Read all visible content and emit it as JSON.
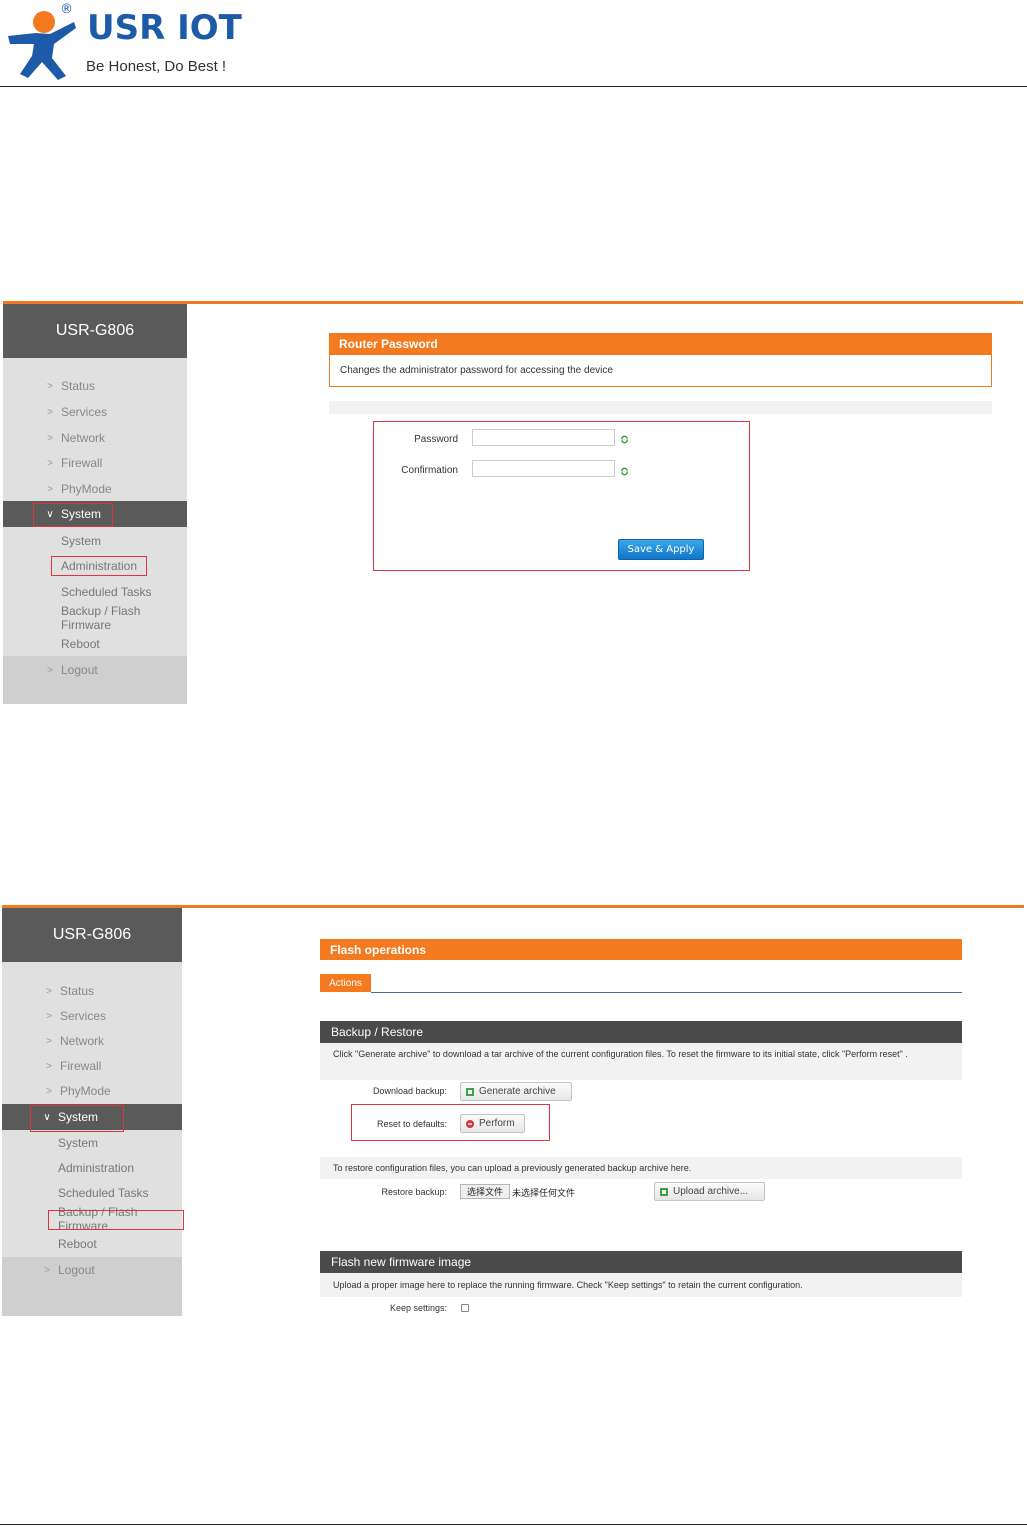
{
  "header": {
    "brand": "USR IOT",
    "registered": "®",
    "slogan": "Be Honest, Do Best !"
  },
  "colors": {
    "accent": "#f47a20",
    "brand": "#1d5aa8",
    "sidebar_bg": "#e0e0e0",
    "sidebar_dark": "#5a5a5a",
    "highlight_box": "#e0343b",
    "primary_button": "#1a86d6"
  },
  "screenshot1": {
    "device_title": "USR-G806",
    "menu": [
      {
        "label": "Status",
        "icon": "chevron-right-icon"
      },
      {
        "label": "Services",
        "icon": "chevron-right-icon"
      },
      {
        "label": "Network",
        "icon": "chevron-right-icon"
      },
      {
        "label": "Firewall",
        "icon": "chevron-right-icon"
      },
      {
        "label": "PhyMode",
        "icon": "chevron-right-icon"
      },
      {
        "label": "System",
        "icon": "chevron-down-icon",
        "active": true
      }
    ],
    "submenu": [
      "System",
      "Administration",
      "Scheduled Tasks",
      "Backup / Flash Firmware",
      "Reboot"
    ],
    "logout": "Logout",
    "section_title": "Router Password",
    "section_desc": "Changes the administrator password for accessing the device",
    "password_label": "Password",
    "password_value": "",
    "confirmation_label": "Confirmation",
    "confirmation_value": "",
    "save_apply": "Save & Apply"
  },
  "screenshot2": {
    "device_title": "USR-G806",
    "menu": [
      {
        "label": "Status",
        "icon": "chevron-right-icon"
      },
      {
        "label": "Services",
        "icon": "chevron-right-icon"
      },
      {
        "label": "Network",
        "icon": "chevron-right-icon"
      },
      {
        "label": "Firewall",
        "icon": "chevron-right-icon"
      },
      {
        "label": "PhyMode",
        "icon": "chevron-right-icon"
      },
      {
        "label": "System",
        "icon": "chevron-down-icon",
        "active": true
      }
    ],
    "submenu": [
      "System",
      "Administration",
      "Scheduled Tasks",
      "Backup / Flash Firmware",
      "Reboot"
    ],
    "logout": "Logout",
    "section_title": "Flash operations",
    "tab_actions": "Actions",
    "backup_title": "Backup / Restore",
    "backup_desc": "Click \"Generate archive\" to download a tar archive of the current configuration files. To reset the firmware to its initial state, click \"Perform reset\" .",
    "download_label": "Download backup:",
    "generate_archive": "Generate archive",
    "reset_label": "Reset to defaults:",
    "perform": "Perform",
    "restore_desc": "To restore configuration files, you can upload a previously generated backup archive here.",
    "restore_label": "Restore backup:",
    "choose_file": "选择文件",
    "no_file": "未选择任何文件",
    "upload_archive": "Upload archive...",
    "flash_title": "Flash new firmware image",
    "flash_desc": "Upload a proper image here to replace the running firmware. Check \"Keep settings\" to retain the current configuration.",
    "keep_settings_label": "Keep settings:",
    "keep_settings_checked": false
  }
}
